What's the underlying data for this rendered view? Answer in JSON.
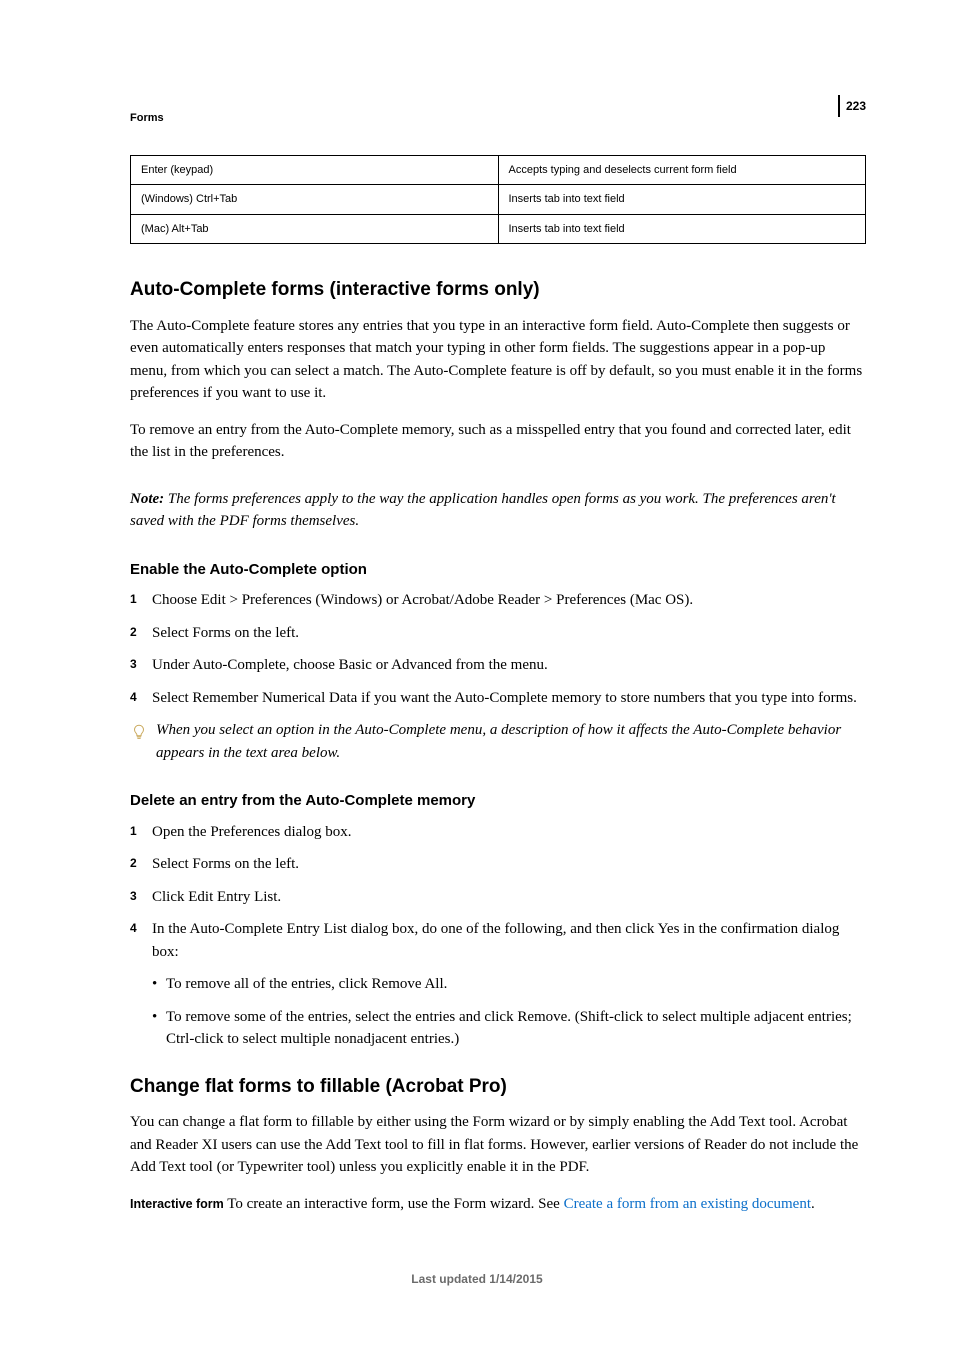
{
  "page_number": "223",
  "section_label": "Forms",
  "table": [
    {
      "key": "Enter (keypad)",
      "val": "Accepts typing and deselects current form field"
    },
    {
      "key": "(Windows) Ctrl+Tab",
      "val": "Inserts tab into text field"
    },
    {
      "key": "(Mac) Alt+Tab",
      "val": "Inserts tab into text field"
    }
  ],
  "h2_autocomplete": "Auto-Complete forms (interactive forms only)",
  "p_ac_1": "The Auto-Complete feature stores any entries that you type in an interactive form field. Auto-Complete then suggests or even automatically enters responses that match your typing in other form fields. The suggestions appear in a pop-up menu, from which you can select a match. The Auto-Complete feature is off by default, so you must enable it in the forms preferences if you want to use it.",
  "p_ac_2": "To remove an entry from the Auto-Complete memory, such as a misspelled entry that you found and corrected later, edit the list in the preferences.",
  "note_label": "Note:",
  "note_text": " The forms preferences apply to the way the application handles open forms as you work. The preferences aren't saved with the PDF forms themselves.",
  "h3_enable": "Enable the Auto-Complete option",
  "enable_steps": [
    "Choose Edit > Preferences (Windows) or Acrobat/Adobe Reader > Preferences (Mac OS).",
    "Select Forms on the left.",
    "Under Auto-Complete, choose Basic or Advanced from the menu.",
    "Select Remember Numerical Data if you want the Auto-Complete memory to store numbers that you type into forms."
  ],
  "tip_text": "When you select an option in the Auto-Complete menu, a description of how it affects the Auto-Complete behavior appears in the text area below.",
  "h3_delete": "Delete an entry from the Auto-Complete memory",
  "delete_steps": [
    "Open the Preferences dialog box.",
    "Select Forms on the left.",
    "Click Edit Entry List.",
    "In the Auto-Complete Entry List dialog box, do one of the following, and then click Yes in the confirmation dialog box:"
  ],
  "delete_bullets": [
    "To remove all of the entries, click Remove All.",
    "To remove some of the entries, select the entries and click Remove. (Shift-click to select multiple adjacent entries; Ctrl-click to select multiple nonadjacent entries.)"
  ],
  "h2_change": "Change flat forms to fillable (Acrobat Pro)",
  "p_change": "You can change a flat form to fillable by either using the Form wizard or by simply enabling the Add Text tool. Acrobat and Reader XI users can use the Add Text tool to fill in flat forms. However, earlier versions of Reader do not include the Add Text tool (or Typewriter tool) unless you explicitly enable it in the PDF.",
  "interactive_label": "Interactive form",
  "interactive_text_1": "  To create an interactive form, use the Form wizard. See ",
  "interactive_link": "Create a form from an existing document",
  "interactive_text_2": ".",
  "footer": "Last updated 1/14/2015"
}
